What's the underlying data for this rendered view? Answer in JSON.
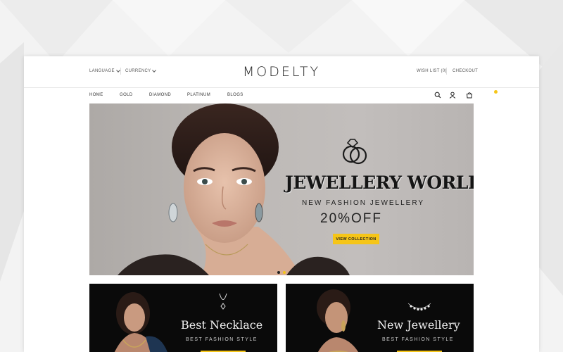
{
  "topbar": {
    "language_label": "LANGUAGE",
    "currency_label": "CURRENCY",
    "logo": "MODELTY",
    "wishlist_label": "WISH LIST (0)",
    "checkout_label": "CHECKOUT"
  },
  "nav": {
    "items": [
      "HOME",
      "GOLD",
      "DIAMOND",
      "PLATINUM",
      "BLOGS"
    ],
    "icons": [
      "search-icon",
      "user-icon",
      "cart-icon"
    ]
  },
  "hero": {
    "title": "JEWELLERY WORLD",
    "subtitle": "NEW FASHION JEWELLERY",
    "offer": "20%OFF",
    "button_label": "VIEW COLLECTION",
    "slides": 2,
    "active_slide": 2
  },
  "banners": [
    {
      "title": "Best Necklace",
      "subtitle": "BEST FASHION STYLE"
    },
    {
      "title": "New Jewellery",
      "subtitle": "BEST FASHION STYLE"
    }
  ],
  "colors": {
    "accent": "#f5c518",
    "text": "#222222",
    "banner_bg": "#0a0a0a"
  }
}
